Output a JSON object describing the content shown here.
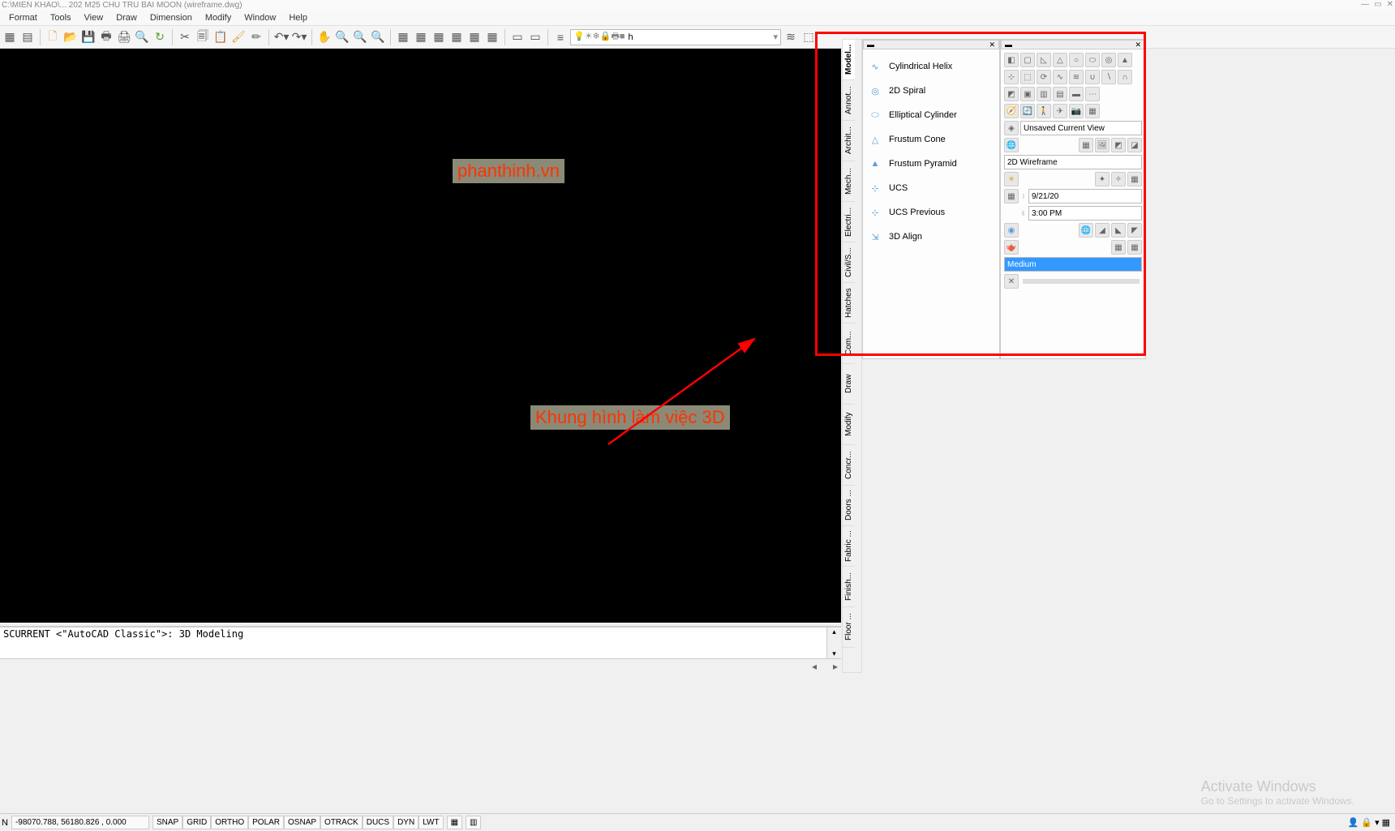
{
  "title": "C:\\MIEN KHAO\\... 202 M25 CHU TRU BAI MOON (wireframe.dwg)",
  "menu": [
    "Format",
    "Tools",
    "View",
    "Draw",
    "Dimension",
    "Modify",
    "Window",
    "Help"
  ],
  "layer_text": "h",
  "drawing_area": {
    "watermark": "phanthinh.vn",
    "annotation": "Khung hình làm việc 3D"
  },
  "vert_tabs": [
    "Model...",
    "Annot...",
    "Archit...",
    "Mech...",
    "Electri...",
    "Civil/S...",
    "Hatches",
    "Com...",
    "Draw",
    "Modify",
    "Concr...",
    "Doors ...",
    "Fabric ...",
    "Finish...",
    "Floor ..."
  ],
  "panel3d": {
    "items": [
      {
        "icon": "helix",
        "label": "Cylindrical Helix"
      },
      {
        "icon": "spiral",
        "label": "2D Spiral"
      },
      {
        "icon": "cyl",
        "label": "Elliptical Cylinder"
      },
      {
        "icon": "cone",
        "label": "Frustum Cone"
      },
      {
        "icon": "pyr",
        "label": "Frustum Pyramid"
      },
      {
        "icon": "ucs",
        "label": "UCS"
      },
      {
        "icon": "ucsp",
        "label": "UCS Previous"
      },
      {
        "icon": "align",
        "label": "3D Align"
      }
    ]
  },
  "right_panel": {
    "view_name": "Unsaved Current View",
    "visual_style": "2D Wireframe",
    "date": "9/21/20",
    "time": "3:00 PM",
    "quality": "Medium"
  },
  "command": {
    "line1": "SCURRENT <\"AutoCAD Classic\">: 3D Modeling",
    "line2": ""
  },
  "status": {
    "prefix": "N",
    "coords": "-98070.788, 56180.826 , 0.000",
    "toggles": [
      "SNAP",
      "GRID",
      "ORTHO",
      "POLAR",
      "OSNAP",
      "OTRACK",
      "DUCS",
      "DYN",
      "LWT"
    ]
  },
  "activate": {
    "title": "Activate Windows",
    "sub": "Go to Settings to activate Windows."
  }
}
